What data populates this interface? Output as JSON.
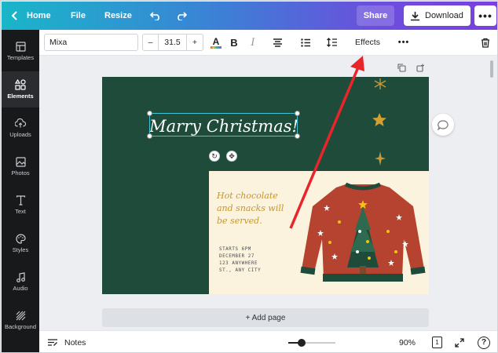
{
  "topbar": {
    "home_label": "Home",
    "file_label": "File",
    "resize_label": "Resize",
    "share_label": "Share",
    "download_label": "Download",
    "more_glyph": "•••"
  },
  "sidebar": {
    "items": [
      {
        "label": "Templates",
        "icon": "templates-icon"
      },
      {
        "label": "Elements",
        "icon": "elements-icon"
      },
      {
        "label": "Uploads",
        "icon": "uploads-icon"
      },
      {
        "label": "Photos",
        "icon": "photos-icon"
      },
      {
        "label": "Text",
        "icon": "text-icon"
      },
      {
        "label": "Styles",
        "icon": "styles-icon"
      },
      {
        "label": "Audio",
        "icon": "audio-icon"
      },
      {
        "label": "Background",
        "icon": "background-icon"
      }
    ],
    "active_index": 1
  },
  "toolbar": {
    "font_value": "Mixa",
    "size_minus": "–",
    "size_value": "31.5",
    "size_plus": "+",
    "bold_label": "B",
    "italic_label": "I",
    "effects_label": "Effects",
    "more_glyph": "•••"
  },
  "canvas": {
    "title_text": "Marry Christmas!",
    "hot_text": "Hot chocolate and snacks will be served.",
    "details_lines": [
      "STARTS 6PM",
      "DECEMBER 27",
      "123 ANYWHERE",
      "ST., ANY CITY"
    ],
    "add_page_label": "+ Add page",
    "bg_color": "#1f4b3a",
    "accent_cream": "#fcf3de",
    "sweater_color": "#b5432f"
  },
  "bottombar": {
    "notes_label": "Notes",
    "zoom_label": "90%",
    "page_count": "1",
    "help_label": "?"
  }
}
